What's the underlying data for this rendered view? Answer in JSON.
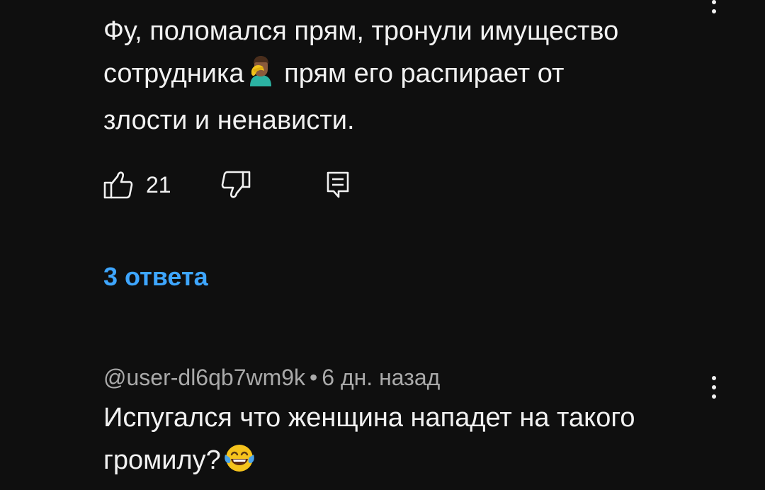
{
  "comments": [
    {
      "text_line1": "Фу, поломался прям, тронули имущество",
      "text_line2a": "сотрудника",
      "emoji1": "man-facepalming-emoji",
      "text_line2b": " прям его распирает от",
      "text_line3": "злости и ненависти.",
      "like_count": "21",
      "replies_label": "3 ответа"
    },
    {
      "author": "@user-dl6qb7wm9k",
      "separator": "•",
      "timestamp": "6 дн. назад",
      "text_line1": "Испугался что женщина нападет на такого",
      "text_line2": "громилу?",
      "emoji1": "face-with-tears-of-joy-emoji"
    }
  ],
  "icons": {
    "like": "thumb-up-icon",
    "dislike": "thumb-down-icon",
    "reply": "comment-reply-icon",
    "more": "more-vertical-icon"
  },
  "colors": {
    "background": "#0f0f0f",
    "text": "#f1f1f1",
    "meta": "#aaaaaa",
    "link": "#3ea6ff"
  }
}
